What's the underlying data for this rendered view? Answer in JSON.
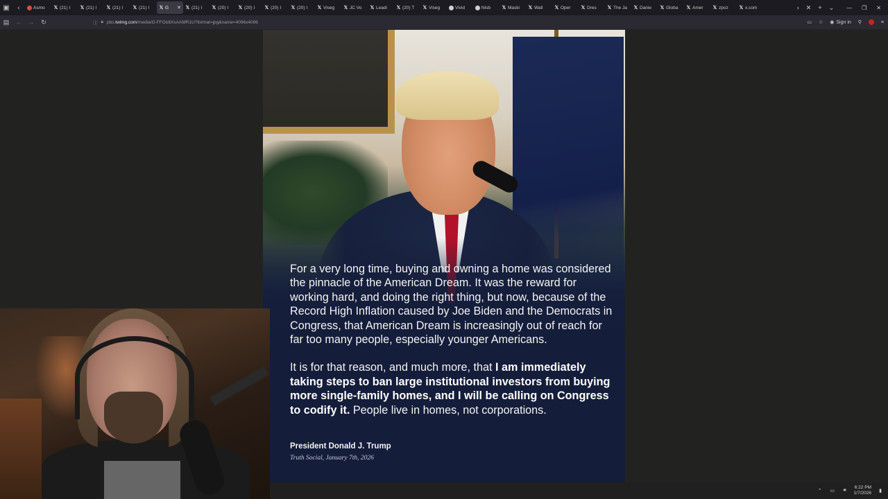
{
  "browser": {
    "tabs": [
      {
        "label": "Asmo",
        "fav": "red"
      },
      {
        "label": "(21) I",
        "fav": "x"
      },
      {
        "label": "(21) I",
        "fav": "x"
      },
      {
        "label": "(21) I",
        "fav": "x"
      },
      {
        "label": "(21) I",
        "fav": "x"
      },
      {
        "label": "G",
        "fav": "x",
        "active": true
      },
      {
        "label": "(21) I",
        "fav": "x"
      },
      {
        "label": "(20) I",
        "fav": "x"
      },
      {
        "label": "(20) I",
        "fav": "x"
      },
      {
        "label": "(20) I",
        "fav": "x"
      },
      {
        "label": "(20) I",
        "fav": "x"
      },
      {
        "label": "Viseg",
        "fav": "x"
      },
      {
        "label": "JC Vo",
        "fav": "x"
      },
      {
        "label": "Leadi",
        "fav": "x"
      },
      {
        "label": "(20) T",
        "fav": "x"
      },
      {
        "label": "Viseg",
        "fav": "x"
      },
      {
        "label": "Vivid",
        "fav": "dot"
      },
      {
        "label": "Nisb",
        "fav": "dot"
      },
      {
        "label": "Maski",
        "fav": "x"
      },
      {
        "label": "Wall",
        "fav": "x"
      },
      {
        "label": "Oper",
        "fav": "x"
      },
      {
        "label": "Dres",
        "fav": "x"
      },
      {
        "label": "The Ja",
        "fav": "x"
      },
      {
        "label": "Danie",
        "fav": "x"
      },
      {
        "label": "Globa",
        "fav": "x"
      },
      {
        "label": "Amer",
        "fav": "x"
      },
      {
        "label": "zpoz",
        "fav": "x"
      },
      {
        "label": "x.com",
        "fav": "x"
      }
    ],
    "url_prefix": "pbs.",
    "url_host": "twimg.com",
    "url_path": "/media/G-FFGb8XsAAMR1U?format=jpg&name=4096x4096",
    "sign_in": "Sign in"
  },
  "post": {
    "quote_p1": "For a very long time, buying and owning a home was considered the pinnacle of the American Dream. It was the reward for working hard, and doing the right thing, but now, because of the Record High Inflation caused by Joe Biden and the Democrats in Congress, that American Dream is increasingly out of reach for far too many people, especially younger Americans.",
    "quote_p2_lead": "It is for that reason, and much more, that ",
    "quote_p2_bold": "I am immediately taking steps to ban large institutional investors from buying more single-family homes, and I will be calling on Congress to codify it.",
    "quote_p2_tail": " People live in homes, not corporations.",
    "attribution": "President Donald J. Trump",
    "attribution_sub": "Truth Social, January 7th, 2026"
  },
  "taskbar": {
    "time": "6:22 PM",
    "date": "1/7/2026"
  }
}
